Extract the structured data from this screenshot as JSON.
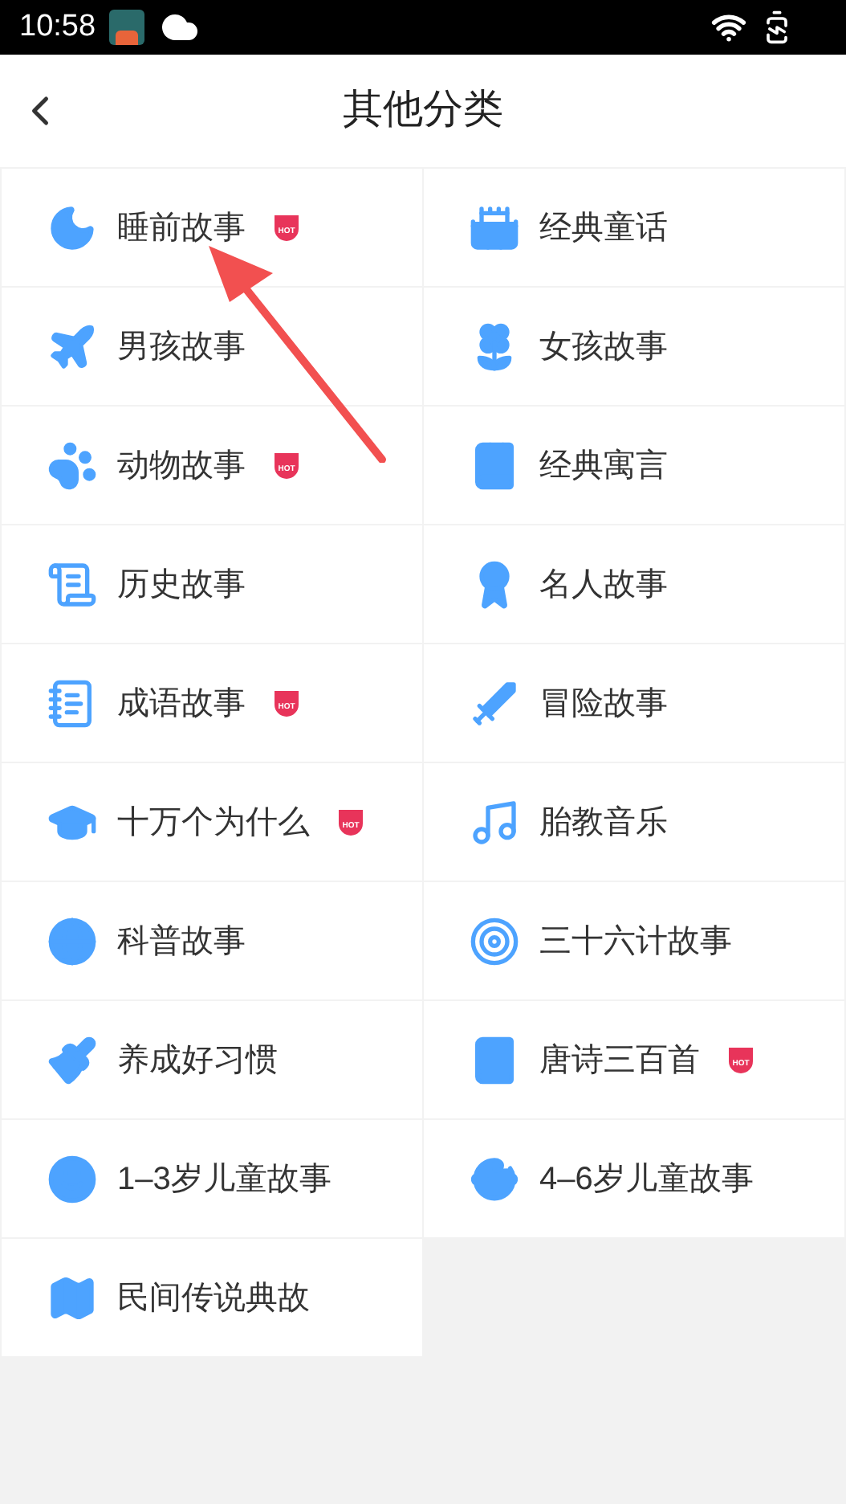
{
  "status_bar": {
    "time": "10:58"
  },
  "header": {
    "title": "其他分类"
  },
  "categories": [
    {
      "label": "睡前故事",
      "hot": true,
      "badge": "HOT"
    },
    {
      "label": "经典童话",
      "hot": false
    },
    {
      "label": "男孩故事",
      "hot": false
    },
    {
      "label": "女孩故事",
      "hot": false
    },
    {
      "label": "动物故事",
      "hot": true,
      "badge": "HOT"
    },
    {
      "label": "经典寓言",
      "hot": false
    },
    {
      "label": "历史故事",
      "hot": false
    },
    {
      "label": "名人故事",
      "hot": false
    },
    {
      "label": "成语故事",
      "hot": true,
      "badge": "HOT"
    },
    {
      "label": "冒险故事",
      "hot": false
    },
    {
      "label": "十万个为什么",
      "hot": true,
      "badge": "HOT"
    },
    {
      "label": "胎教音乐",
      "hot": false
    },
    {
      "label": "科普故事",
      "hot": false
    },
    {
      "label": "三十六计故事",
      "hot": false
    },
    {
      "label": "养成好习惯",
      "hot": false
    },
    {
      "label": "唐诗三百首",
      "hot": true,
      "badge": "HOT"
    },
    {
      "label": "1–3岁儿童故事",
      "hot": false
    },
    {
      "label": "4–6岁儿童故事",
      "hot": false
    },
    {
      "label": "民间传说典故",
      "hot": false
    }
  ]
}
